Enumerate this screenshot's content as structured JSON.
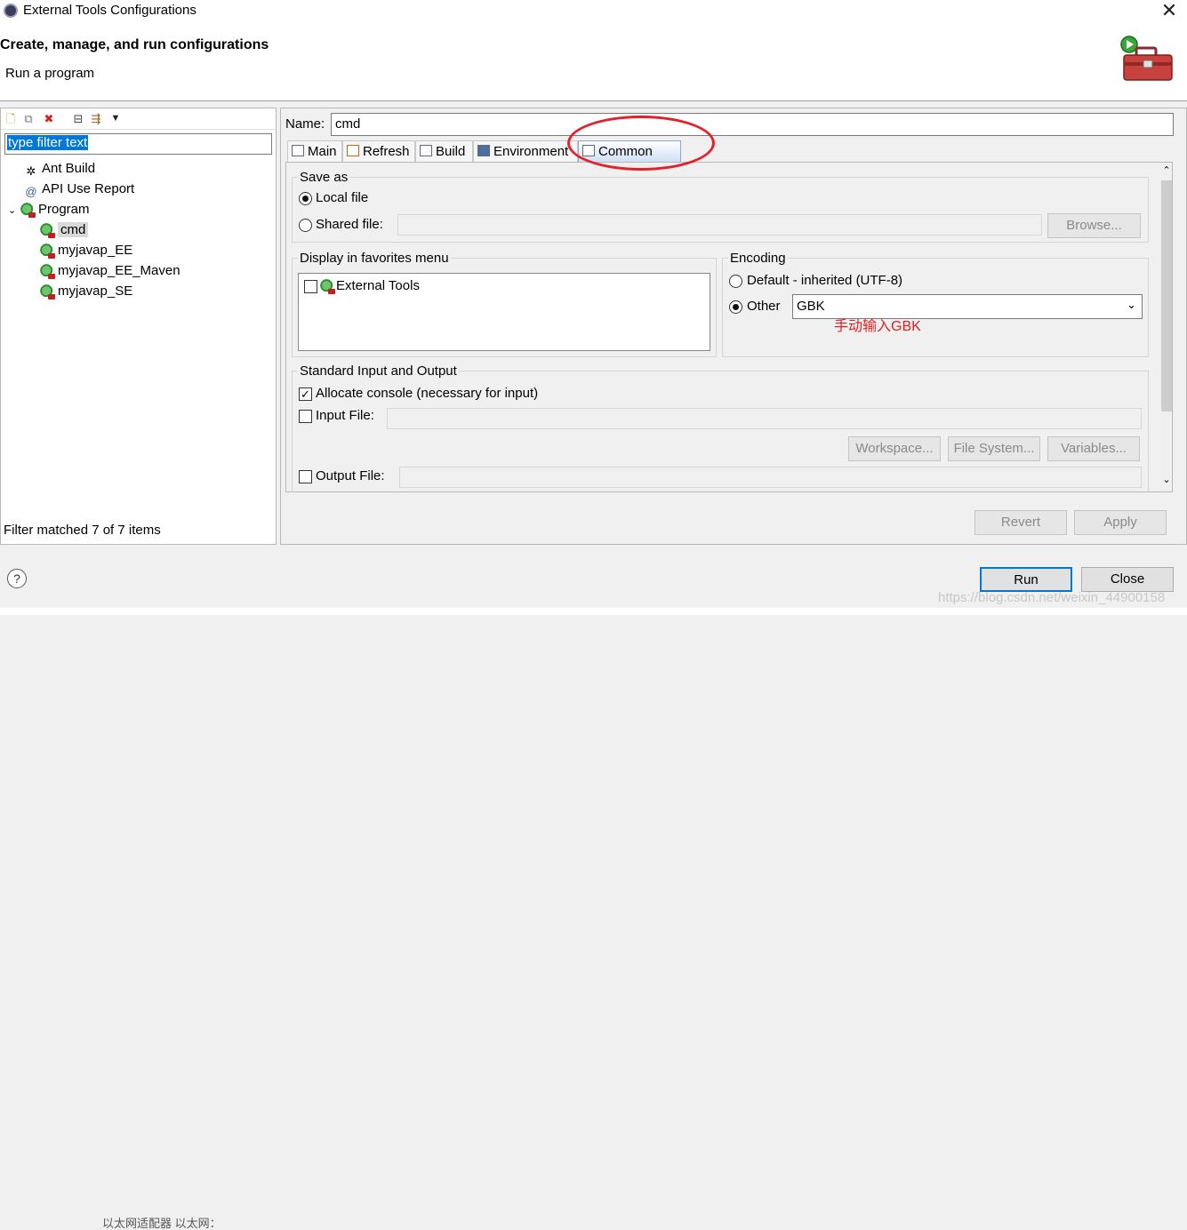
{
  "window": {
    "title": "External Tools Configurations",
    "close": "✕"
  },
  "header": {
    "title": "Create, manage, and run configurations",
    "subtitle": "Run a program"
  },
  "left": {
    "filter_text": "type filter text",
    "tree": [
      {
        "label": "Ant Build",
        "icon": "ant-icon"
      },
      {
        "label": "API Use Report",
        "icon": "report-icon"
      },
      {
        "label": "Program",
        "icon": "program-icon"
      },
      {
        "label": "cmd",
        "icon": "run-config-icon"
      },
      {
        "label": "myjavap_EE",
        "icon": "run-config-icon"
      },
      {
        "label": "myjavap_EE_Maven",
        "icon": "run-config-icon"
      },
      {
        "label": "myjavap_SE",
        "icon": "run-config-icon"
      }
    ],
    "status": "Filter matched 7 of 7 items"
  },
  "right": {
    "name_label": "Name:",
    "name_value": "cmd",
    "tabs": [
      "Main",
      "Refresh",
      "Build",
      "Environment",
      "Common"
    ],
    "save_as": {
      "title": "Save as",
      "local": "Local file",
      "shared": "Shared file:",
      "browse": "Browse..."
    },
    "favorites": {
      "title": "Display in favorites menu",
      "item": "External Tools"
    },
    "encoding": {
      "title": "Encoding",
      "default": "Default - inherited (UTF-8)",
      "other": "Other",
      "value": "GBK",
      "annotation": "手动输入GBK"
    },
    "stdio": {
      "title": "Standard Input and Output",
      "allocate": "Allocate console (necessary for input)",
      "input_file": "Input File:",
      "workspace": "Workspace...",
      "file_system": "File System...",
      "variables": "Variables...",
      "output_file": "Output File:"
    },
    "revert": "Revert",
    "apply": "Apply"
  },
  "footer": {
    "run": "Run",
    "close": "Close",
    "help": "?",
    "watermark": "https://blog.csdn.net/weixin_44900158",
    "bottom_text": "以太网适配器 以太网："
  },
  "colors": {
    "selection": "#0078d7",
    "annotation": "#e02020",
    "focus": "#0078d7"
  }
}
